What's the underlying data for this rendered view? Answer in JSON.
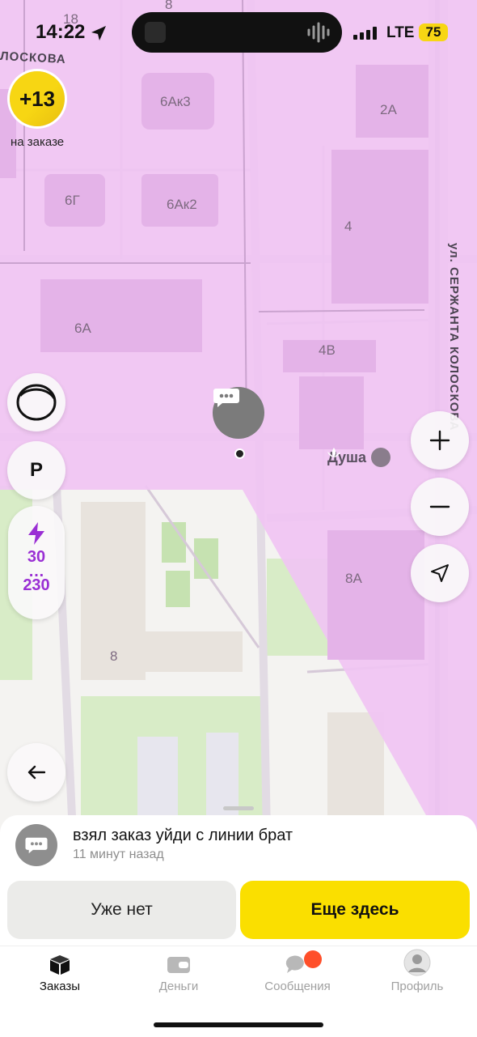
{
  "status": {
    "time": "14:22",
    "network": "LTE",
    "battery": "75"
  },
  "map": {
    "labels": [
      "18",
      "8",
      "6Ак3",
      "2А",
      "6Г",
      "6Ак2",
      "4",
      "6А",
      "4В",
      "8А",
      "8"
    ],
    "poi": "Душа",
    "streets": {
      "top": "ЛОСКОВА",
      "right": "ул. СЕРЖАНТА КОЛОСКОВА"
    }
  },
  "bonus": {
    "value": "+13",
    "label": "на заказе"
  },
  "controls": {
    "parking": "P",
    "range_from": "30",
    "range_dots": "…",
    "range_to": "230"
  },
  "message": {
    "text": "взял заказ уйди с линии брат",
    "time": "11 минут назад"
  },
  "actions": {
    "no": "Уже нет",
    "yes": "Еще здесь"
  },
  "tabs": [
    {
      "label": "Заказы",
      "color": "#111111"
    },
    {
      "label": "Деньги",
      "color": "#a0a0a0"
    },
    {
      "label": "Сообщения",
      "color": "#a0a0a0"
    },
    {
      "label": "Профиль",
      "color": "#a0a0a0"
    }
  ],
  "colors": {
    "zone": "#f0c4f3",
    "accent": "#fadf00",
    "range": "#9a2fd4",
    "notification": "#ff4f2a"
  }
}
